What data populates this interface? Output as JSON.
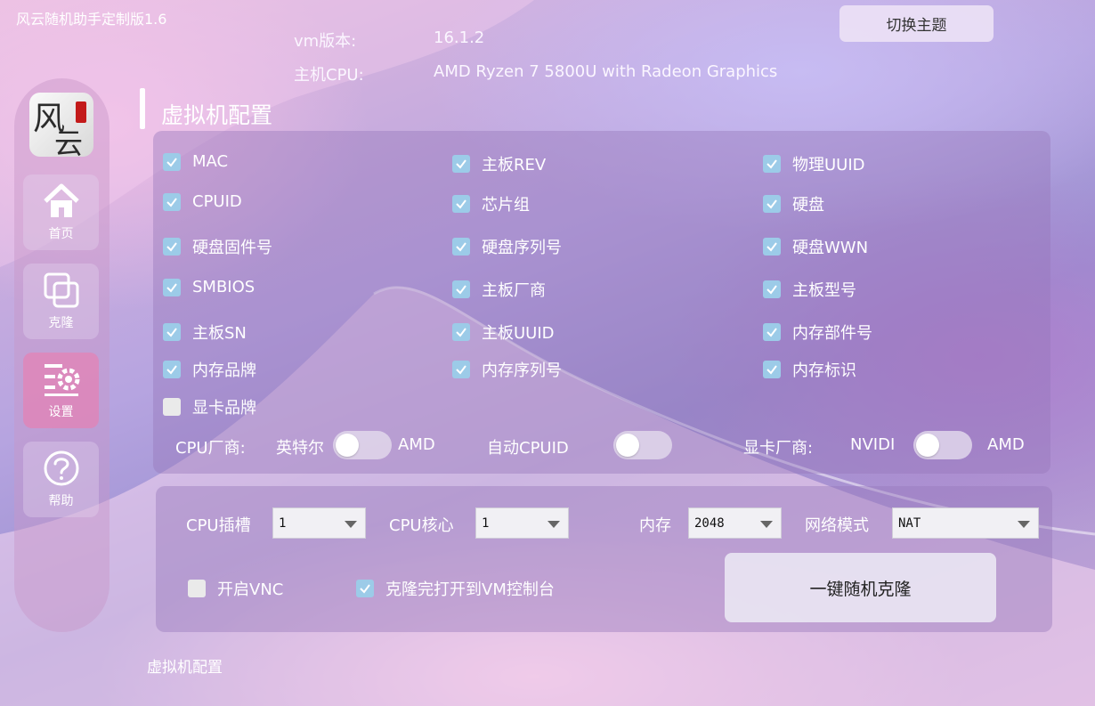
{
  "app": {
    "title": "风云随机助手定制版1.6"
  },
  "header": {
    "theme_button": "切换主题",
    "vm_version_label": "vm版本:",
    "vm_version_value": "16.1.2",
    "host_cpu_label": "主机CPU:",
    "host_cpu_value": "AMD Ryzen 7 5800U with Radeon Graphics"
  },
  "sidebar": {
    "items": [
      {
        "label": "首页",
        "icon": "home-icon"
      },
      {
        "label": "克隆",
        "icon": "clone-icon"
      },
      {
        "label": "设置",
        "icon": "settings-icon",
        "active": true
      },
      {
        "label": "帮助",
        "icon": "help-icon"
      }
    ]
  },
  "section": {
    "title": "虚拟机配置"
  },
  "options": {
    "mac": {
      "label": "MAC",
      "checked": true
    },
    "board_rev": {
      "label": "主板REV",
      "checked": true
    },
    "physical_uuid": {
      "label": "物理UUID",
      "checked": true
    },
    "cpuid": {
      "label": "CPUID",
      "checked": true
    },
    "chipset": {
      "label": "芯片组",
      "checked": true
    },
    "hard_disk": {
      "label": "硬盘",
      "checked": true
    },
    "disk_firmware": {
      "label": "硬盘固件号",
      "checked": true
    },
    "disk_serial": {
      "label": "硬盘序列号",
      "checked": true
    },
    "disk_wwn": {
      "label": "硬盘WWN",
      "checked": true
    },
    "smbios": {
      "label": "SMBIOS",
      "checked": true
    },
    "board_vendor": {
      "label": "主板厂商",
      "checked": true
    },
    "board_model": {
      "label": "主板型号",
      "checked": true
    },
    "board_sn": {
      "label": "主板SN",
      "checked": true
    },
    "board_uuid": {
      "label": "主板UUID",
      "checked": true
    },
    "memory_part": {
      "label": "内存部件号",
      "checked": true
    },
    "memory_brand": {
      "label": "内存品牌",
      "checked": true
    },
    "memory_serial": {
      "label": "内存序列号",
      "checked": true
    },
    "memory_id": {
      "label": "内存标识",
      "checked": true
    },
    "gpu_brand": {
      "label": "显卡品牌",
      "checked": false
    }
  },
  "toggles": {
    "cpu_vendor": {
      "label": "CPU厂商:",
      "left": "英特尔",
      "right": "AMD"
    },
    "auto_cpuid": {
      "label": "自动CPUID"
    },
    "gpu_vendor": {
      "label": "显卡厂商:",
      "left": "NVIDI",
      "right": "AMD"
    }
  },
  "config": {
    "cpu_socket": {
      "label": "CPU插槽",
      "value": "1"
    },
    "cpu_cores": {
      "label": "CPU核心",
      "value": "1"
    },
    "memory": {
      "label": "内存",
      "value": "2048"
    },
    "network": {
      "label": "网络模式",
      "value": "NAT"
    },
    "vnc": {
      "label": "开启VNC",
      "checked": false
    },
    "open_console": {
      "label": "克隆完打开到VM控制台",
      "checked": true
    },
    "clone_button": "一键随机克隆"
  },
  "status": {
    "text": "虚拟机配置"
  },
  "colors": {
    "checkbox_on": "#9ccbe8",
    "checkbox_off": "#eaeaea",
    "active_nav": "#f078aa"
  }
}
